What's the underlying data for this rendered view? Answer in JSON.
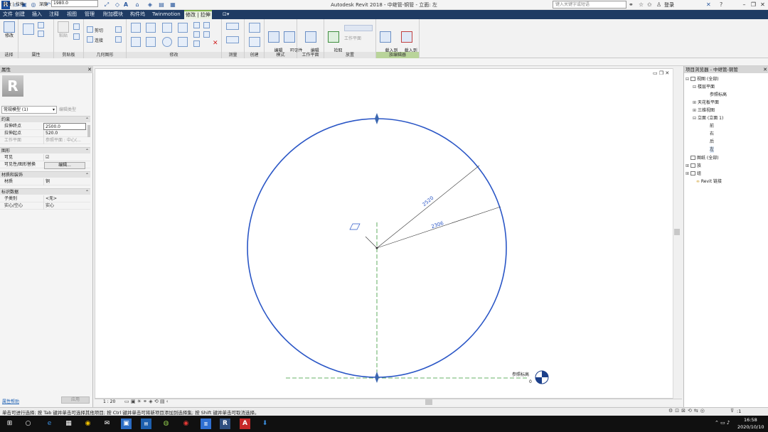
{
  "window": {
    "title": "Autodesk Revit 2018 -   中继管-铜管 - 立面: 左",
    "search_placeholder": "键入关键字或短语",
    "login": "登录",
    "app_letter": "R"
  },
  "ribbon_tabs": [
    "文件",
    "创建",
    "插入",
    "注释",
    "视图",
    "管理",
    "附加模块",
    "构件坞",
    "Twinmotion",
    "修改 | 拉伸",
    "⊡▾"
  ],
  "ribbon": {
    "modify_label": "修改",
    "paste_label": "粘贴",
    "cut_label": "剪切",
    "join_label": "连接",
    "panels": {
      "select": "选择",
      "properties": "属性",
      "clipboard": "剪贴板",
      "geometry": "几何图形",
      "modify": "修改",
      "measure": "测量",
      "create": "创建",
      "mode": "模式",
      "workplane": "工作平面",
      "place": "放置",
      "family_editor": "族编辑器"
    },
    "buttons": {
      "edit_extrusion": "编辑\n拉伸",
      "visibility_settings": "可见性\n设置",
      "edit_workplane": "编辑\n工作平面",
      "pick_new": "拾取\n新的",
      "workplane_small": "工作平面",
      "load_into_project": "载入到\n项目",
      "load_into_project_close": "载入到\n项目并关闭"
    }
  },
  "options_bar": {
    "mode": "修改 | 拉伸",
    "depth_label": "深度",
    "depth_value": "1980.0"
  },
  "properties": {
    "title": "属性",
    "type_name": "常规模型 (1)",
    "edit_type": "编辑类型",
    "groups": {
      "constraints": "约束",
      "graphics": "图形",
      "materials": "材质和装饰",
      "identity": "标识数据"
    },
    "rows": {
      "extrusion_end_label": "拉伸终点",
      "extrusion_end_value": "2500.0",
      "extrusion_start_label": "拉伸起点",
      "extrusion_start_value": "520.0",
      "workplane_label": "工作平面",
      "workplane_value": "参照平面 : 中心(...",
      "visible_label": "可见",
      "visible_value": "☑",
      "vg_override_label": "可见性/图形替换",
      "vg_override_value": "编辑...",
      "material_label": "材质",
      "material_value": "铜",
      "subcategory_label": "子类别",
      "subcategory_value": "<无>",
      "solid_void_label": "实心/空心",
      "solid_void_value": "实心"
    },
    "help": "属性帮助",
    "apply": "应用"
  },
  "canvas": {
    "dim_outer": "2520",
    "dim_inner": "2306",
    "level_label": "参照标高",
    "level_value": "0",
    "scale": "1 : 20"
  },
  "browser": {
    "title": "项目浏览器 - 中继管-铜管",
    "items": [
      {
        "label": "视图 (全部)",
        "exp": "⊟"
      },
      {
        "label": "楼层平面",
        "exp": "⊟"
      },
      {
        "label": "参照标高",
        "exp": ""
      },
      {
        "label": "天花板平面",
        "exp": "⊞"
      },
      {
        "label": "三维视图",
        "exp": "⊞"
      },
      {
        "label": "立面 (立面 1)",
        "exp": "⊟"
      },
      {
        "label": "前",
        "exp": ""
      },
      {
        "label": "右",
        "exp": ""
      },
      {
        "label": "后",
        "exp": ""
      },
      {
        "label": "左",
        "exp": ""
      },
      {
        "label": "图纸 (全部)",
        "exp": ""
      },
      {
        "label": "族",
        "exp": "⊞"
      },
      {
        "label": "组",
        "exp": "⊞"
      },
      {
        "label": "Revit 链接",
        "exp": ""
      }
    ]
  },
  "status": {
    "text": "单击可进行选择; 按 Tab 键并单击可选择其他项目; 按 Ctrl 键并单击可将新项目添加到选择集; 按 Shift 键并单击可取消选择。",
    "filter_count": ":1"
  },
  "taskbar": {
    "time": "16:58",
    "date": "2020/10/10"
  },
  "colors": {
    "ribbon_tab_bg": "#1f3b63",
    "context_tab": "#7fb04a",
    "circle": "#2a56c6",
    "ref_plane": "#3a9a3a"
  }
}
